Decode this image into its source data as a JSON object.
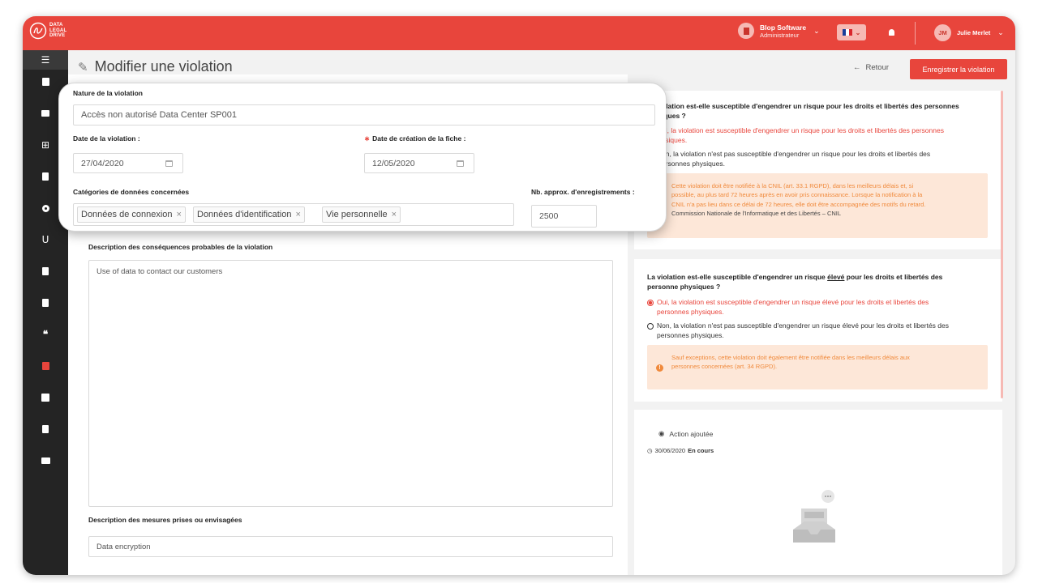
{
  "brand": {
    "logo_text": [
      "DATA",
      "LEGAL",
      "DRIVE"
    ],
    "accent": "#e8453c"
  },
  "topbar": {
    "company_name": "Blop Software",
    "company_role": "Administrateur",
    "user_initials": "JM",
    "user_name": "Julie Merlet"
  },
  "sidebar": {
    "icons": [
      "menu-collapse-icon",
      "building-icon",
      "briefcase-icon",
      "table-icon",
      "document-icon",
      "target-icon",
      "stethoscope-icon",
      "file-icon",
      "file-export-icon",
      "quote-icon",
      "alert-icon",
      "register-icon",
      "clipboard-icon",
      "card-icon"
    ],
    "active": "alert-icon"
  },
  "header": {
    "title": "Modifier une violation",
    "back_label": "Retour",
    "save_label": "Enregistrer la violation"
  },
  "form": {
    "nature_label": "Nature de la violation",
    "nature_value": "Accès non autorisé Data Center SP001",
    "date_violation_label": "Date de la violation",
    "date_violation_value": "27/04/2020",
    "date_creation_label": "Date de création de la fiche",
    "date_creation_value": "12/05/2020",
    "categories_label": "Catégories de données concernées",
    "categories": [
      "Données de connexion",
      "Données d'identification",
      "Vie personnelle"
    ],
    "records_label": "Nb. approx. d'enregistrements",
    "records_value": "2500",
    "consequences_label": "Description des conséquences probables de la violation",
    "consequences_value": "Use of data to contact our customers",
    "measures_label": "Description des mesures prises ou envisagées",
    "measures_value": "Data encryption"
  },
  "risk_card": {
    "title_l1": "olation est-elle susceptible d'engendrer un risque pour les droits et libertés des personnes",
    "title_l2": "iques ?",
    "opt_yes_l1": "ui, la violation est susceptible d'engendrer un risque pour les droits et libertés des personnes",
    "opt_yes_l2": "ysiques.",
    "opt_no_l1": "on, la violation n'est pas susceptible d'engendrer un risque pour les droits et libertés des",
    "opt_no_l2": "ersonnes physiques.",
    "alert_l1": "Cette violation doit être notifiée à la CNIL (art. 33.1 RGPD), dans les meilleurs délais et, si",
    "alert_l2": "possible, au plus tard 72 heures après en avoir pris connaissance. Lorsque la notification à la",
    "alert_l3": "CNIL n'a pas lieu dans ce délai de 72 heures, elle doit être accompagnée des motifs du retard.",
    "alert_l4": "Commission Nationale de l'Informatique et des Libertés – CNIL"
  },
  "high_risk_card": {
    "title_pre": "La violation est-elle susceptible d'engendrer un risque ",
    "title_em": "élevé",
    "title_post": " pour les droits et libertés des",
    "title_l2": "personne physiques ?",
    "opt_yes_l1": "Oui, la violation est susceptible d'engendrer un risque élevé pour les droits et libertés des",
    "opt_yes_l2": "personnes physiques.",
    "opt_no_l1": "Non, la violation n'est pas susceptible d'engendrer un risque élevé pour les droits et libertés des",
    "opt_no_l2": "personnes physiques.",
    "alert_l1": "Sauf exceptions, cette violation doit également être notifiée dans les meilleurs délais aux",
    "alert_l2": "personnes concernées (art. 34 RGPD)."
  },
  "action_card": {
    "action_label": "Action ajoutée",
    "date": "30/06/2020",
    "status": "En cours"
  }
}
